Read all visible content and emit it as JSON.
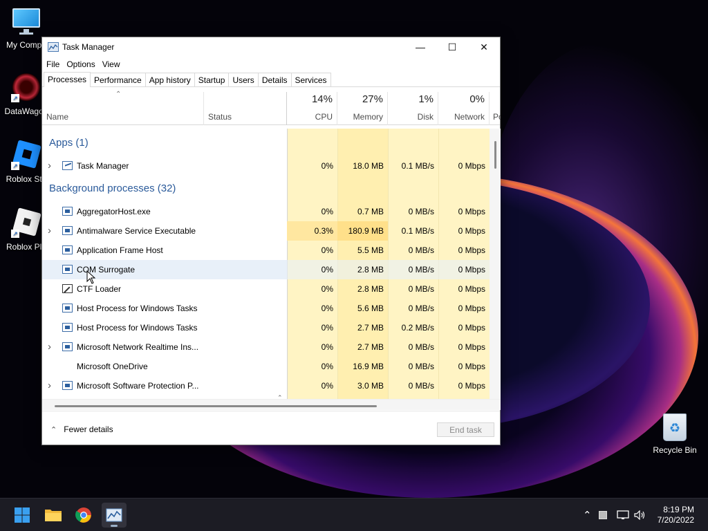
{
  "desktop": {
    "icons": [
      {
        "label": "My Compu",
        "icon": "monitor-icon"
      },
      {
        "label": "DataWagon",
        "icon": "datawagon-icon"
      },
      {
        "label": "Roblox Stu",
        "icon": "roblox-studio-icon"
      },
      {
        "label": "Roblox Pla",
        "icon": "roblox-player-icon"
      }
    ],
    "recycle_bin": "Recycle Bin"
  },
  "window": {
    "title": "Task Manager",
    "controls": {
      "minimize": "—",
      "maximize": "☐",
      "close": "✕"
    },
    "menu": [
      "File",
      "Options",
      "View"
    ],
    "tabs": [
      "Processes",
      "Performance",
      "App history",
      "Startup",
      "Users",
      "Details",
      "Services"
    ],
    "active_tab": "Processes"
  },
  "columns": {
    "name": "Name",
    "status": "Status",
    "cpu": {
      "pct": "14%",
      "label": "CPU"
    },
    "memory": {
      "pct": "27%",
      "label": "Memory"
    },
    "disk": {
      "pct": "1%",
      "label": "Disk"
    },
    "network": {
      "pct": "0%",
      "label": "Network"
    },
    "power_truncated": "Po"
  },
  "groups": {
    "apps": "Apps (1)",
    "background": "Background processes (32)"
  },
  "apps": [
    {
      "name": "Task Manager",
      "expand": true,
      "icon": "task-manager",
      "cpu": "0%",
      "memory": "18.0 MB",
      "disk": "0.1 MB/s",
      "network": "0 Mbps"
    }
  ],
  "processes": [
    {
      "name": "AggregatorHost.exe",
      "expand": false,
      "icon": "window",
      "cpu": "0%",
      "memory": "0.7 MB",
      "disk": "0 MB/s",
      "network": "0 Mbps"
    },
    {
      "name": "Antimalware Service Executable",
      "expand": true,
      "icon": "window",
      "cpu": "0.3%",
      "memory": "180.9 MB",
      "disk": "0.1 MB/s",
      "network": "0 Mbps"
    },
    {
      "name": "Application Frame Host",
      "expand": false,
      "icon": "window",
      "cpu": "0%",
      "memory": "5.5 MB",
      "disk": "0 MB/s",
      "network": "0 Mbps"
    },
    {
      "name": "COM Surrogate",
      "expand": false,
      "icon": "window",
      "cpu": "0%",
      "memory": "2.8 MB",
      "disk": "0 MB/s",
      "network": "0 Mbps",
      "hover": true
    },
    {
      "name": "CTF Loader",
      "expand": false,
      "icon": "pen",
      "cpu": "0%",
      "memory": "2.8 MB",
      "disk": "0 MB/s",
      "network": "0 Mbps"
    },
    {
      "name": "Host Process for Windows Tasks",
      "expand": false,
      "icon": "window",
      "cpu": "0%",
      "memory": "5.6 MB",
      "disk": "0 MB/s",
      "network": "0 Mbps"
    },
    {
      "name": "Host Process for Windows Tasks",
      "expand": false,
      "icon": "window",
      "cpu": "0%",
      "memory": "2.7 MB",
      "disk": "0.2 MB/s",
      "network": "0 Mbps"
    },
    {
      "name": "Microsoft Network Realtime Ins...",
      "expand": true,
      "icon": "window",
      "cpu": "0%",
      "memory": "2.7 MB",
      "disk": "0 MB/s",
      "network": "0 Mbps"
    },
    {
      "name": "Microsoft OneDrive",
      "expand": false,
      "icon": "none",
      "cpu": "0%",
      "memory": "16.9 MB",
      "disk": "0 MB/s",
      "network": "0 Mbps"
    },
    {
      "name": "Microsoft Software Protection P...",
      "expand": true,
      "icon": "window",
      "cpu": "0%",
      "memory": "3.0 MB",
      "disk": "0 MB/s",
      "network": "0 Mbps"
    }
  ],
  "footer": {
    "fewer_details": "Fewer details",
    "end_task": "End task"
  },
  "taskbar": {
    "pinned": [
      "start-icon",
      "file-explorer-icon",
      "chrome-icon",
      "task-manager-icon"
    ],
    "time": "8:19 PM",
    "date": "7/20/2022"
  }
}
